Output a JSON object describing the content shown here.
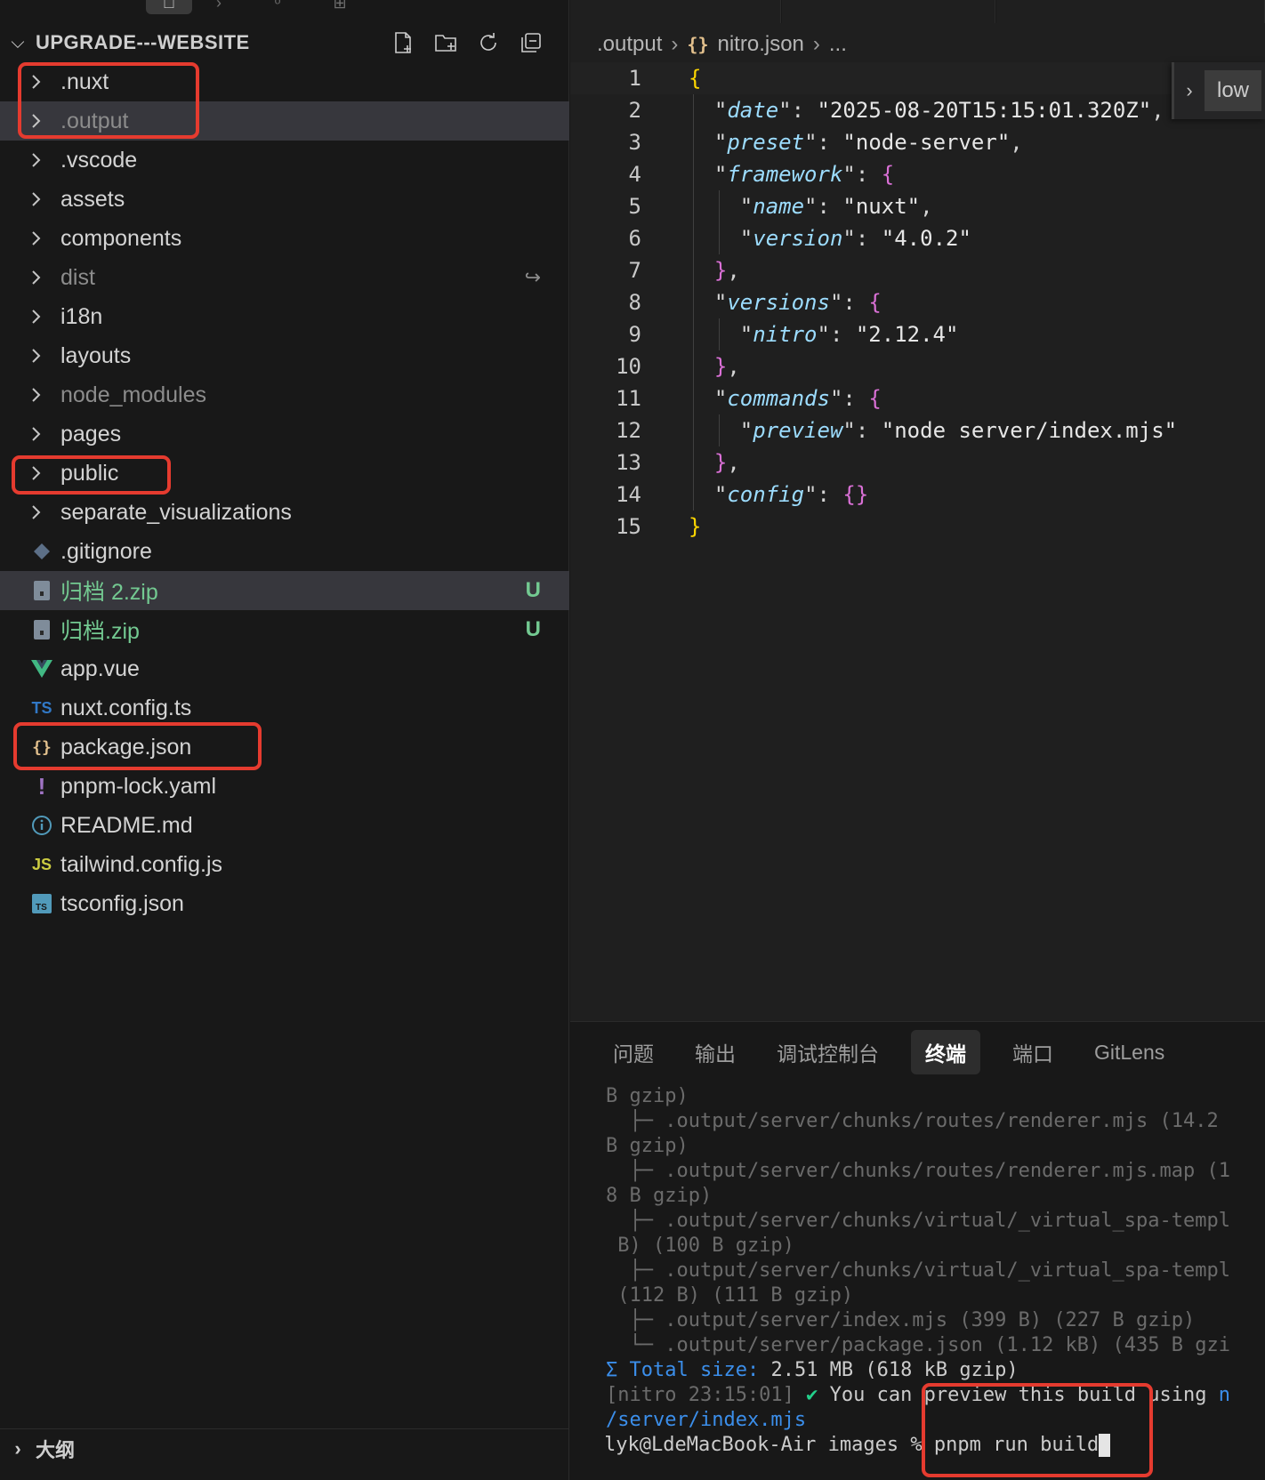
{
  "explorer": {
    "title": "UPGRADE---WEBSITE",
    "items": [
      {
        "label": ".nuxt",
        "type": "folder",
        "style": "normal"
      },
      {
        "label": ".output",
        "type": "folder",
        "style": "dim"
      },
      {
        "label": ".vscode",
        "type": "folder",
        "style": "normal"
      },
      {
        "label": "assets",
        "type": "folder",
        "style": "normal"
      },
      {
        "label": "components",
        "type": "folder",
        "style": "normal"
      },
      {
        "label": "dist",
        "type": "folder",
        "style": "dim"
      },
      {
        "label": "i18n",
        "type": "folder",
        "style": "normal"
      },
      {
        "label": "layouts",
        "type": "folder",
        "style": "normal"
      },
      {
        "label": "node_modules",
        "type": "folder",
        "style": "dim"
      },
      {
        "label": "pages",
        "type": "folder",
        "style": "normal"
      },
      {
        "label": "public",
        "type": "folder",
        "style": "normal"
      },
      {
        "label": "separate_visualizations",
        "type": "folder",
        "style": "normal"
      },
      {
        "label": ".gitignore",
        "type": "file",
        "icon": "git-icon",
        "style": "normal"
      },
      {
        "label": "归档 2.zip",
        "type": "file",
        "icon": "zip-icon",
        "style": "untracked",
        "badge": "U"
      },
      {
        "label": "归档.zip",
        "type": "file",
        "icon": "zip-icon",
        "style": "untracked",
        "badge": "U"
      },
      {
        "label": "app.vue",
        "type": "file",
        "icon": "vue-icon",
        "glyph": "V",
        "style": "normal"
      },
      {
        "label": "nuxt.config.ts",
        "type": "file",
        "icon": "typescript-icon",
        "glyph": "TS",
        "style": "normal"
      },
      {
        "label": "package.json",
        "type": "file",
        "icon": "json-icon",
        "glyph": "{}",
        "style": "normal"
      },
      {
        "label": "pnpm-lock.yaml",
        "type": "file",
        "icon": "yaml-icon",
        "glyph": "!",
        "style": "normal"
      },
      {
        "label": "README.md",
        "type": "file",
        "icon": "info-icon",
        "glyph": "i",
        "style": "normal"
      },
      {
        "label": "tailwind.config.js",
        "type": "file",
        "icon": "javascript-icon",
        "glyph": "JS",
        "style": "normal"
      },
      {
        "label": "tsconfig.json",
        "type": "file",
        "icon": "tsconfig-icon",
        "glyph": "TS",
        "style": "normal"
      }
    ],
    "outline_label": "大纲"
  },
  "editor": {
    "breadcrumb": [
      ".output",
      "nitro.json",
      "..."
    ],
    "find_widget_label": "low",
    "lines": [
      "{",
      "  \"date\": \"2025-08-20T15:15:01.320Z\",",
      "  \"preset\": \"node-server\",",
      "  \"framework\": {",
      "    \"name\": \"nuxt\",",
      "    \"version\": \"4.0.2\"",
      "  },",
      "  \"versions\": {",
      "    \"nitro\": \"2.12.4\"",
      "  },",
      "  \"commands\": {",
      "    \"preview\": \"node server/index.mjs\"",
      "  },",
      "  \"config\": {}",
      "}"
    ]
  },
  "panel": {
    "tabs": [
      "问题",
      "输出",
      "调试控制台",
      "终端",
      "端口",
      "GitLens"
    ],
    "active_tab": "终端",
    "terminal_lines": [
      "B gzip)",
      "  ├─ .output/server/chunks/routes/renderer.mjs (14.2",
      "B gzip)",
      "  ├─ .output/server/chunks/routes/renderer.mjs.map (1",
      "8 B gzip)",
      "  ├─ .output/server/chunks/virtual/_virtual_spa-templ",
      " B) (100 B gzip)",
      "  ├─ .output/server/chunks/virtual/_virtual_spa-templ",
      " (112 B) (111 B gzip)",
      "  ├─ .output/server/index.mjs (399 B) (227 B gzip)",
      "  └─ .output/server/package.json (1.12 kB) (435 B gzi"
    ],
    "total_symbol": "Σ",
    "total_label": "Total size:",
    "total_value": "2.51 MB (618 kB gzip)",
    "nitro_tag": "[nitro 23:15:01]",
    "nitro_check": "✔",
    "nitro_message": "You can preview this build using",
    "nitro_cmd": "n",
    "nitro_path": "/server/index.mjs",
    "prompt_text": "lyk@LdeMacBook-Air images % pnpm run build"
  }
}
